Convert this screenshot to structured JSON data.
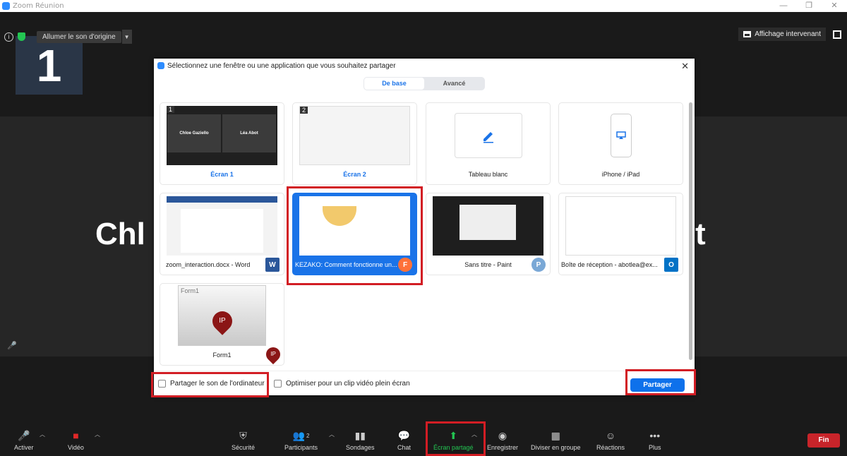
{
  "window": {
    "title": "Zoom Réunion",
    "minimize": "—",
    "restore": "❐",
    "close": "✕"
  },
  "meeting": {
    "original_sound": "Allumer le son d'origine",
    "speaker_view": "Affichage intervenant",
    "thumb_number": "1",
    "big_name_left": "Chl",
    "big_name_right": "t"
  },
  "dialog": {
    "title": "Sélectionnez une fenêtre ou une application que vous souhaitez partager",
    "tabs": [
      "De base",
      "Avancé"
    ],
    "tiles": [
      {
        "label": "Écran 1",
        "badge": "1",
        "left_name": "Chloe Gaziello",
        "right_name": "Léa Abot"
      },
      {
        "label": "Écran 2",
        "badge": "2"
      },
      {
        "label": "Tableau blanc"
      },
      {
        "label": "iPhone / iPad"
      },
      {
        "label": "zoom_interaction.docx - Word",
        "app": "W"
      },
      {
        "label": "KEZAKO: Comment fonctionne un...",
        "app": "F"
      },
      {
        "label": "Sans titre - Paint",
        "app": "P"
      },
      {
        "label": "Boîte de réception - abotlea@ex...",
        "app": "O"
      },
      {
        "label": "Form1",
        "app": "IP",
        "form_title": "Form1"
      }
    ],
    "share_sound": "Partager le son de l'ordinateur",
    "optimize_video": "Optimiser pour un clip vidéo plein écran",
    "share_button": "Partager"
  },
  "toolbar": {
    "mute": "Activer",
    "video": "Vidéo",
    "security": "Sécurité",
    "participants": "Participants",
    "participants_count": "2",
    "polls": "Sondages",
    "chat": "Chat",
    "share_screen": "Écran partagé",
    "record": "Enregistrer",
    "breakout": "Diviser en groupe",
    "reactions": "Réactions",
    "more": "Plus",
    "end": "Fin"
  },
  "colors": {
    "accent": "#0e71eb",
    "highlight": "#d21d24",
    "share_green": "#23c552",
    "end_red": "#c8242a"
  }
}
